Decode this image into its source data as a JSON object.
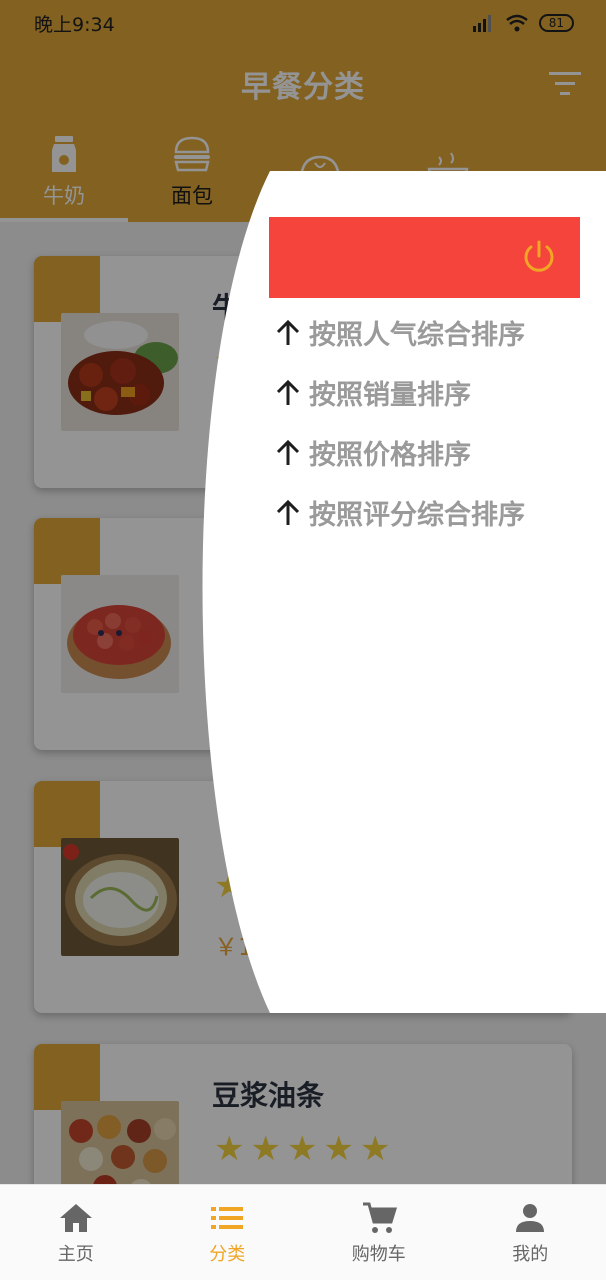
{
  "status_bar": {
    "time": "晚上9:34",
    "battery": "81"
  },
  "app_bar": {
    "title": "早餐分类",
    "filter_icon": "filter-icon"
  },
  "tabs": [
    {
      "label": "牛奶",
      "icon": "milk-icon",
      "active": true
    },
    {
      "label": "面包",
      "icon": "burger-icon",
      "active": false
    },
    {
      "label": "",
      "icon": "bun-icon",
      "active": false
    },
    {
      "label": "",
      "icon": "bowl-icon",
      "active": false
    }
  ],
  "products": [
    {
      "name": "牛",
      "price": "",
      "stars": 0
    },
    {
      "name": "",
      "price": "",
      "stars": 0
    },
    {
      "name": "",
      "price": "￥1",
      "stars": 1
    },
    {
      "name": "豆浆油条",
      "price": "",
      "stars": 5
    }
  ],
  "side_panel": {
    "power_icon": "power-icon",
    "sort_options": [
      {
        "label": "按照人气综合排序",
        "icon": "arrow-up-icon"
      },
      {
        "label": "按照销量排序",
        "icon": "arrow-up-icon"
      },
      {
        "label": "按照价格排序",
        "icon": "arrow-up-icon"
      },
      {
        "label": "按照评分综合排序",
        "icon": "arrow-up-icon"
      }
    ]
  },
  "bottom_nav": [
    {
      "label": "主页",
      "icon": "home-icon",
      "active": false
    },
    {
      "label": "分类",
      "icon": "list-icon",
      "active": true
    },
    {
      "label": "购物车",
      "icon": "cart-icon",
      "active": false
    },
    {
      "label": "我的",
      "icon": "person-icon",
      "active": false
    }
  ],
  "colors": {
    "accent": "#e0a83a",
    "header_red": "#f5443b",
    "star": "#f4d03f",
    "active_nav": "#f0a524"
  }
}
